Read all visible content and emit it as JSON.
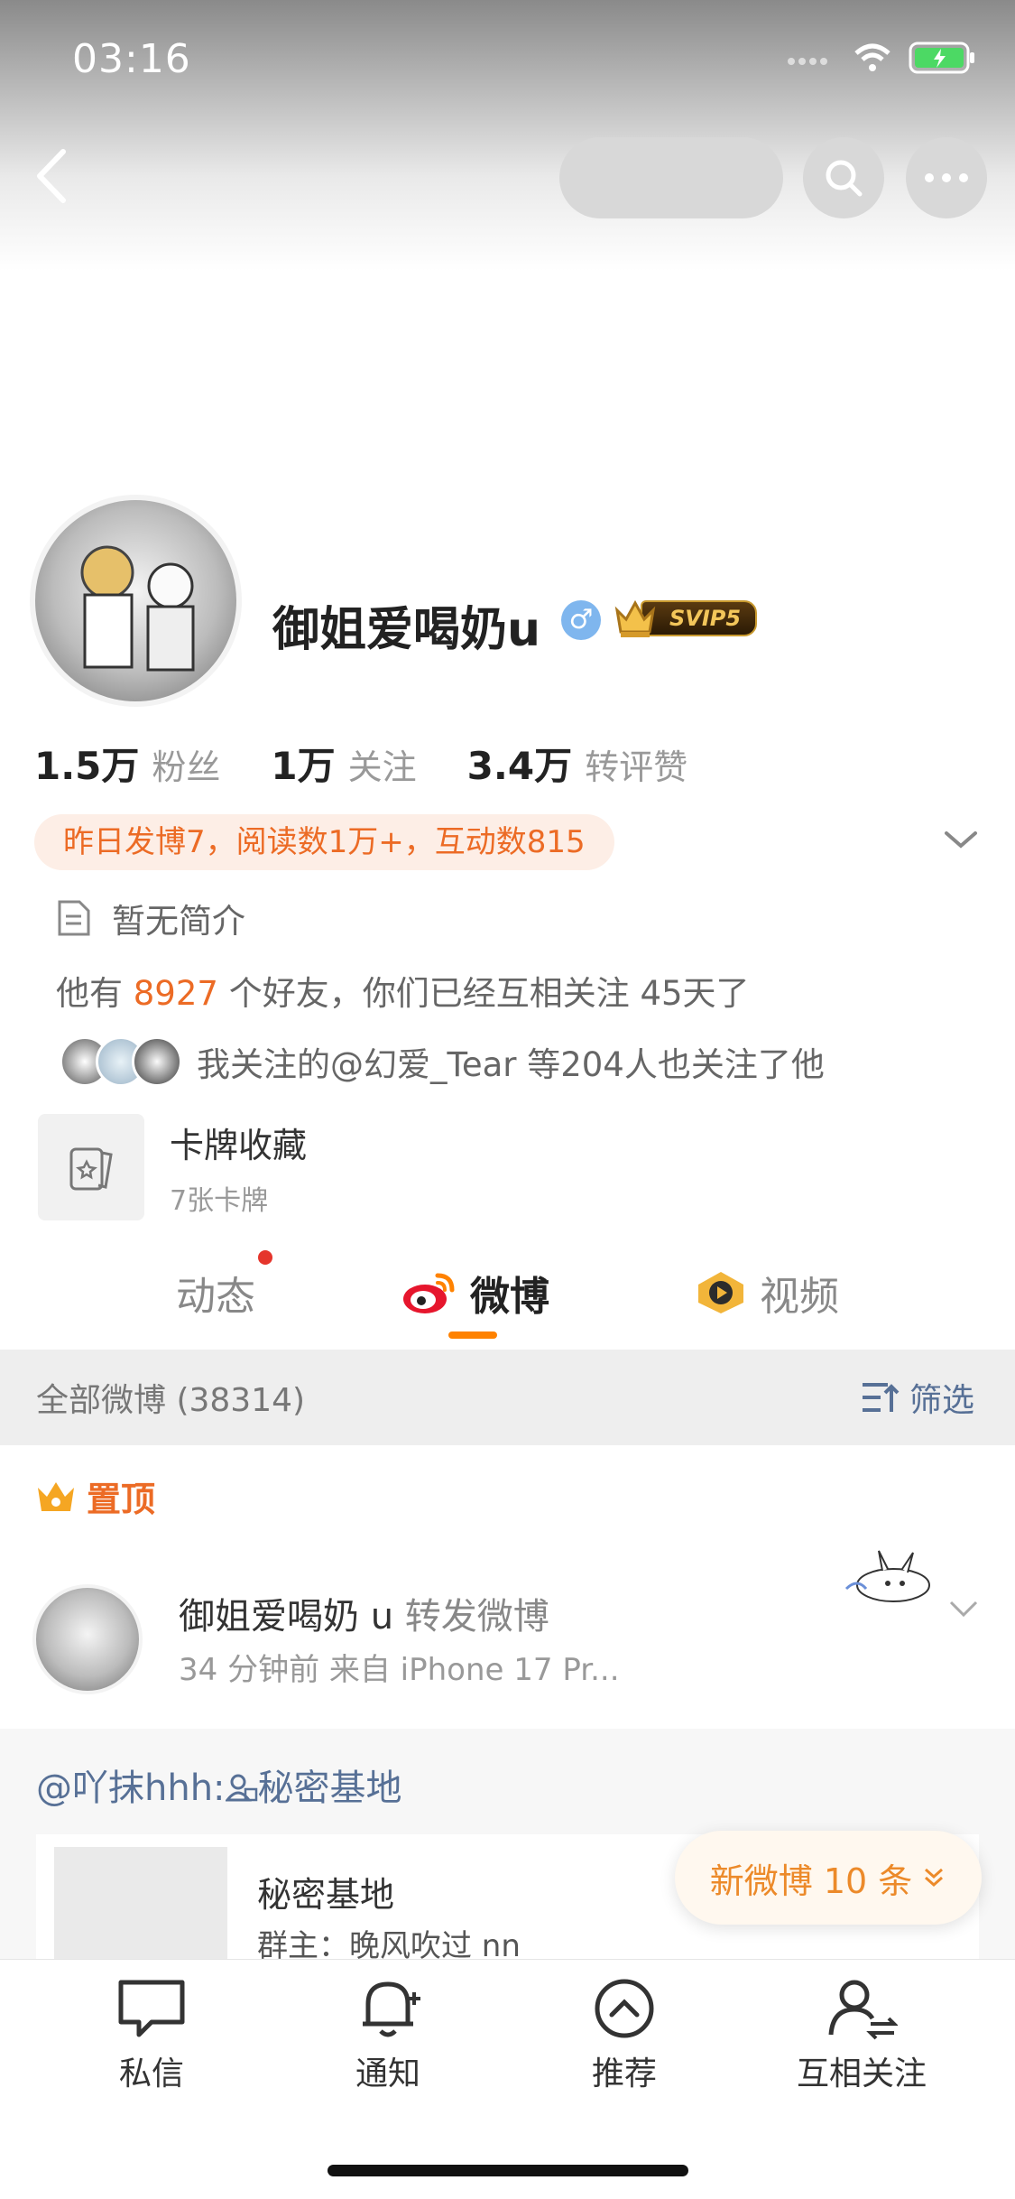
{
  "status_bar": {
    "time": "03:16"
  },
  "profile": {
    "name": "御姐爱喝奶u",
    "gender_symbol": "♂",
    "svip_label": "SVIP5",
    "stats": [
      {
        "value": "1.5万",
        "label": "粉丝"
      },
      {
        "value": "1万",
        "label": "关注"
      },
      {
        "value": "3.4万",
        "label": "转评赞"
      }
    ],
    "activity": "昨日发博7，阅读数1万+，互动数815",
    "bio": "暂无简介",
    "friends_prefix": "他有",
    "friends_count": "8927",
    "friends_suffix": "个好友，你们已经互相关注 45天了",
    "mutual_follow": "我关注的@幻爱_Tear 等204人也关注了他",
    "card_title": "卡牌收藏",
    "card_sub": "7张卡牌"
  },
  "tabs": [
    {
      "label": "动态"
    },
    {
      "label": "微博"
    },
    {
      "label": "视频"
    }
  ],
  "feed": {
    "all_label": "全部微博 (38314)",
    "filter_label": "筛选",
    "pinned_label": "置顶",
    "post": {
      "author": "御姐爱喝奶 u",
      "action": " 转发微博",
      "meta": "34 分钟前  来自 iPhone 17 Pr...",
      "repost_text": "@吖抹hhh:",
      "repost_link": "秘密基地",
      "group_title": "秘密基地",
      "group_sub": "群主：晚风吹过 nn"
    },
    "new_posts": "新微博 10 条"
  },
  "bottom_nav": [
    {
      "label": "私信",
      "icon": "message-icon"
    },
    {
      "label": "通知",
      "icon": "bell-icon"
    },
    {
      "label": "推荐",
      "icon": "up-arrow-icon"
    },
    {
      "label": "互相关注",
      "icon": "mutual-follow-icon"
    }
  ],
  "colors": {
    "accent": "#ff8200",
    "link": "#577096",
    "orange_text": "#ec6b25"
  }
}
